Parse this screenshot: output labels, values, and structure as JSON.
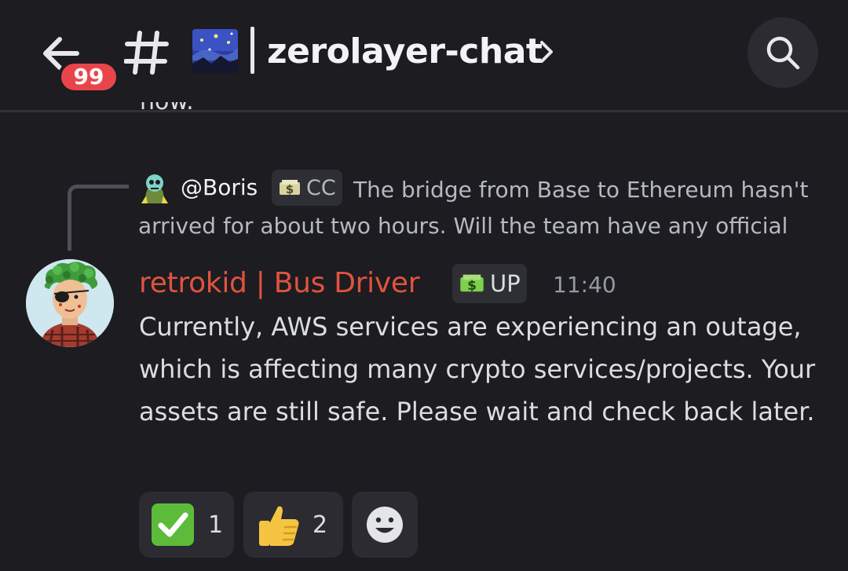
{
  "header": {
    "unread_count": "99",
    "channel_name": "zerolayer-chat"
  },
  "cutoff_text": "now.",
  "reply": {
    "author": "@Boris",
    "tag": "CC",
    "text": "The bridge from Base to Ethereum hasn't arrived for about two hours. Will the team have any official"
  },
  "message": {
    "author": "retrokid | Bus Driver",
    "tag": "UP",
    "timestamp": "11:40",
    "body": "Currently, AWS services are experiencing an outage, which is affecting many crypto services/projects. Your assets are still safe. Please wait and check back later."
  },
  "reactions": [
    {
      "emoji": "check-mark-emoji",
      "count": "1"
    },
    {
      "emoji": "thumbs-up-emoji",
      "count": "2"
    }
  ],
  "colors": {
    "background": "#1c1c21",
    "author_color": "#e0533e",
    "badge_red": "#e8454a",
    "muted_text": "#b5bac1",
    "timestamp": "#949ba4"
  }
}
